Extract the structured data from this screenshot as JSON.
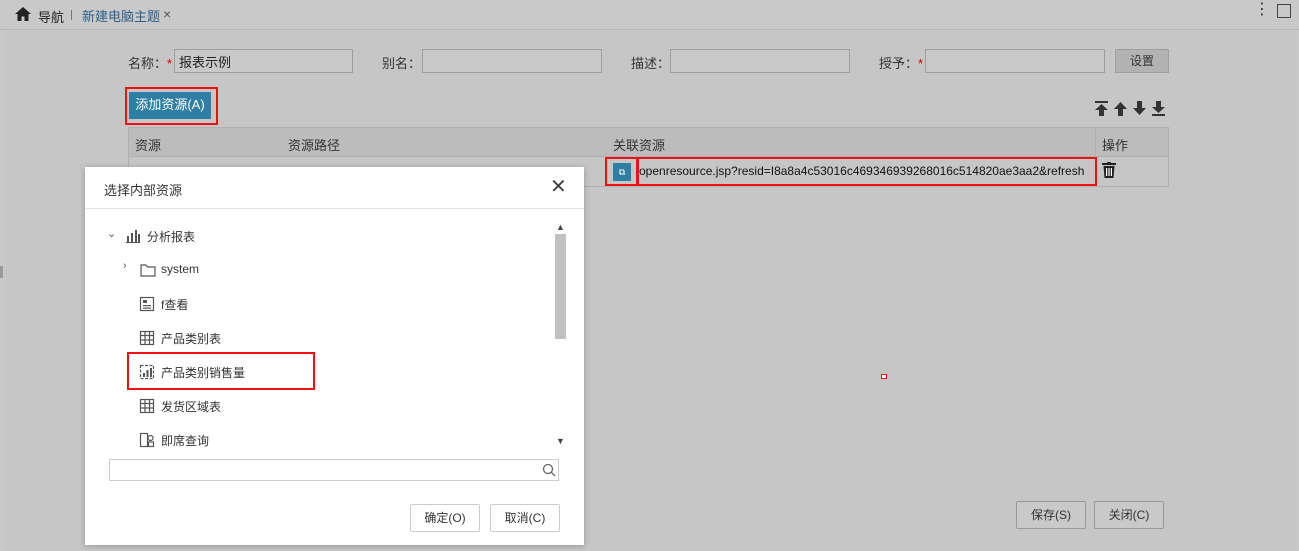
{
  "header": {
    "nav_label": "导航",
    "tab_label": "新建电脑主题",
    "close_glyph": "×",
    "more_glyph": "⋮"
  },
  "form": {
    "name_label": "名称：",
    "name_value": "报表示例",
    "alias_label": "别名：",
    "alias_value": "",
    "desc_label": "描述：",
    "desc_value": "",
    "grant_label": "授予：",
    "grant_value": "",
    "required_mark": "*",
    "settings_label": "设置"
  },
  "toolbar": {
    "add_resource_label": "添加资源(A)"
  },
  "table": {
    "columns": [
      "资源",
      "资源路径",
      "关联资源",
      "操作"
    ],
    "rows": [
      {
        "resource": "",
        "path": "",
        "linked_resource": "openresource.jsp?resid=I8a8a4c53016c469346939268016c514820ae3aa2&refresh",
        "link_button_glyph": "⧉"
      }
    ]
  },
  "dialog": {
    "title": "选择内部资源",
    "close_glyph": "✕",
    "tree": [
      {
        "label": "分析报表",
        "icon": "bar-chart-icon",
        "expanded": true
      },
      {
        "label": "system",
        "icon": "folder-icon",
        "expanded": false
      },
      {
        "label": "f查看",
        "icon": "image-report-icon"
      },
      {
        "label": "产品类别表",
        "icon": "table-icon"
      },
      {
        "label": "产品类别销售量",
        "icon": "chart-report-icon"
      },
      {
        "label": "发货区域表",
        "icon": "table-icon"
      },
      {
        "label": "即席查询",
        "icon": "adhoc-query-icon"
      }
    ],
    "search_value": "",
    "ok_label": "确定(O)",
    "cancel_label": "取消(C)"
  },
  "footer": {
    "save_label": "保存(S)",
    "close_label": "关闭(C)"
  },
  "colors": {
    "accent": "#2e7fa3",
    "highlight": "#e11111",
    "overlay": "#c6c6c6"
  }
}
